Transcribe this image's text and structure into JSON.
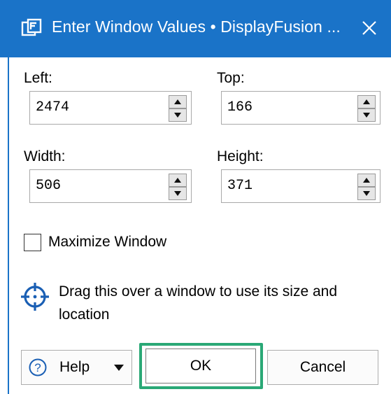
{
  "window": {
    "title": "Enter Window Values • DisplayFusion ...",
    "app_icon": "displayfusion-icon",
    "close_icon": "close-icon",
    "accent_color": "#1a73c8"
  },
  "fields": {
    "left": {
      "label": "Left:",
      "value": "2474"
    },
    "top": {
      "label": "Top:",
      "value": "166"
    },
    "width": {
      "label": "Width:",
      "value": "506"
    },
    "height": {
      "label": "Height:",
      "value": "371"
    }
  },
  "maximize": {
    "label": "Maximize Window",
    "checked": false
  },
  "target": {
    "icon": "crosshair-target-icon",
    "text": "Drag this over a window to use its size and location"
  },
  "buttons": {
    "help": "Help",
    "ok": "OK",
    "cancel": "Cancel",
    "ok_highlight_color": "#2aa876"
  }
}
